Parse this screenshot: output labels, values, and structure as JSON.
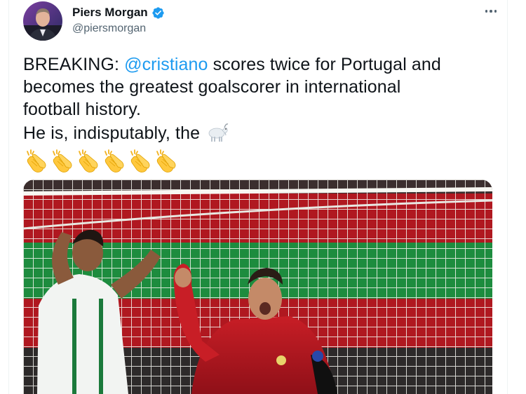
{
  "tweet": {
    "author": {
      "display_name": "Piers Morgan",
      "handle": "@piersmorgan",
      "verified": true
    },
    "text": {
      "prefix": "BREAKING: ",
      "mention": "@cristiano",
      "line1_rest": " scores twice for Portugal and",
      "line2": "becomes the greatest goalscorer in international",
      "line3": "football history.",
      "line4": "He is, indisputably, the ",
      "emoji_inline": "goat-emoji",
      "claps_count": 6,
      "claps_emoji": "clapping-hands-emoji"
    },
    "icons": {
      "more": "more-options-icon",
      "verified": "verified-badge-icon"
    },
    "colors": {
      "accent": "#1d9bf0",
      "text": "#0f1419",
      "secondary": "#536471"
    }
  }
}
